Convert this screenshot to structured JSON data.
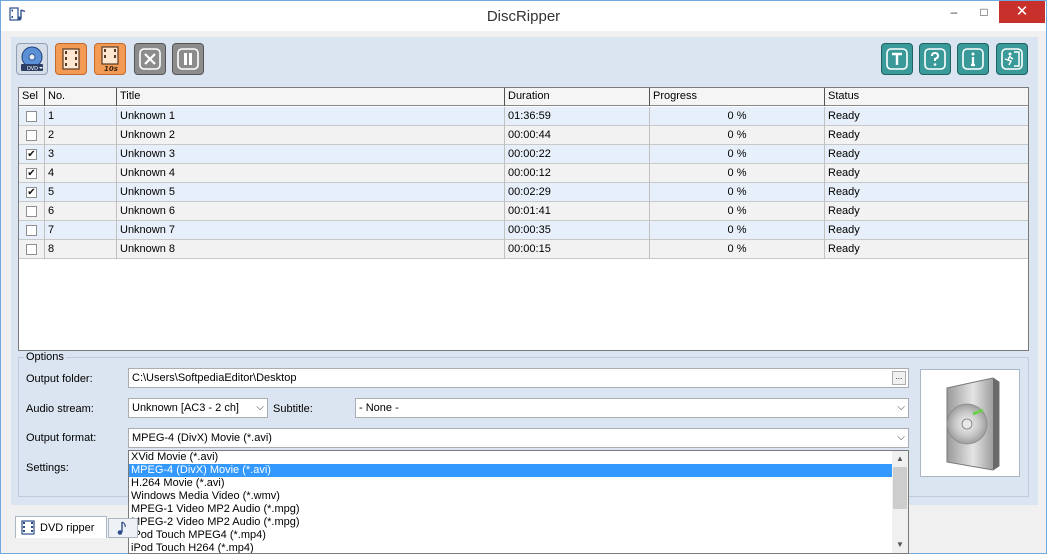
{
  "window": {
    "title": "DiscRipper",
    "minimize": "–",
    "maximize": "□",
    "close": "✕"
  },
  "toolbar": {
    "left_buttons": [
      "dvd-disc-icon",
      "save-icon",
      "save-10s-icon",
      "cancel-icon",
      "pause-icon"
    ],
    "right_buttons": [
      "titles-icon",
      "help-icon",
      "info-icon",
      "exit-icon"
    ],
    "dvd_label": "DVD",
    "ten_label": "10s"
  },
  "table": {
    "columns": [
      "Sel",
      "No.",
      "Title",
      "Duration",
      "Progress",
      "Status"
    ],
    "rows": [
      {
        "checked": false,
        "no": "1",
        "title": "Unknown 1",
        "duration": "01:36:59",
        "progress": "0 %",
        "status": "Ready"
      },
      {
        "checked": false,
        "no": "2",
        "title": "Unknown 2",
        "duration": "00:00:44",
        "progress": "0 %",
        "status": "Ready"
      },
      {
        "checked": true,
        "no": "3",
        "title": "Unknown 3",
        "duration": "00:00:22",
        "progress": "0 %",
        "status": "Ready"
      },
      {
        "checked": true,
        "no": "4",
        "title": "Unknown 4",
        "duration": "00:00:12",
        "progress": "0 %",
        "status": "Ready"
      },
      {
        "checked": true,
        "no": "5",
        "title": "Unknown 5",
        "duration": "00:02:29",
        "progress": "0 %",
        "status": "Ready"
      },
      {
        "checked": false,
        "no": "6",
        "title": "Unknown 6",
        "duration": "00:01:41",
        "progress": "0 %",
        "status": "Ready"
      },
      {
        "checked": false,
        "no": "7",
        "title": "Unknown 7",
        "duration": "00:00:35",
        "progress": "0 %",
        "status": "Ready"
      },
      {
        "checked": false,
        "no": "8",
        "title": "Unknown 8",
        "duration": "00:00:15",
        "progress": "0 %",
        "status": "Ready"
      }
    ]
  },
  "options": {
    "legend": "Options",
    "output_folder_label": "Output folder:",
    "output_folder_value": "C:\\Users\\SoftpediaEditor\\Desktop",
    "browse_label": "...",
    "audio_stream_label": "Audio stream:",
    "audio_stream_value": "Unknown [AC3 - 2 ch]",
    "subtitle_label": "Subtitle:",
    "subtitle_value": "- None -",
    "output_format_label": "Output format:",
    "output_format_value": "MPEG-4 (DivX) Movie (*.avi)",
    "settings_label": "Settings:"
  },
  "format_list": {
    "items": [
      "XVid Movie (*.avi)",
      "MPEG-4 (DivX) Movie (*.avi)",
      "H.264 Movie (*.avi)",
      "Windows Media Video (*.wmv)",
      "MPEG-1 Video MP2 Audio (*.mpg)",
      "MPEG-2 Video MP2 Audio (*.mpg)",
      "iPod Touch MPEG4 (*.mp4)",
      "iPod Touch H264 (*.mp4)"
    ],
    "selected_index": 1
  },
  "tabs": {
    "active_label": "DVD ripper"
  },
  "colors": {
    "accent_orange": "#f39a55",
    "teal": "#2a8a8a",
    "selection_blue": "#3399ff",
    "close_red": "#c7302b"
  }
}
